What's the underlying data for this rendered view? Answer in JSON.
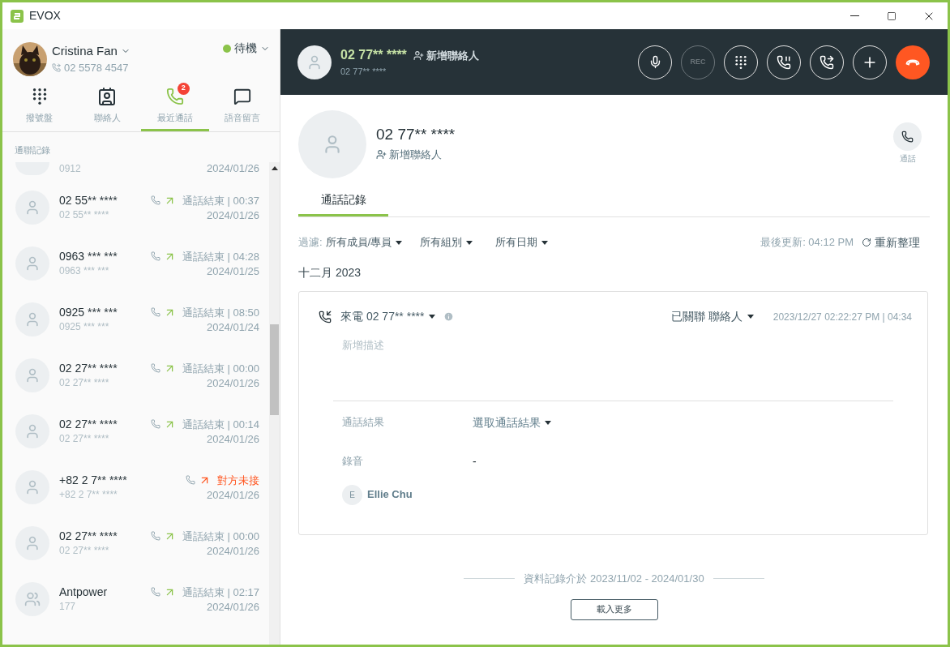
{
  "window": {
    "title": "EVOX"
  },
  "user": {
    "name": "Cristina Fan",
    "phone": "02 5578 4547",
    "status": {
      "label": "待機",
      "color": "#8bc34a"
    }
  },
  "nav_tabs": [
    {
      "kind": "dialpad",
      "label": "撥號盤",
      "selected": false
    },
    {
      "kind": "contacts",
      "label": "聯絡人",
      "selected": false
    },
    {
      "kind": "recent",
      "label": "最近通話",
      "selected": true,
      "badge": "2"
    },
    {
      "kind": "voicemail",
      "label": "語音留言",
      "selected": false
    }
  ],
  "section_label": "通聯記錄",
  "partial_row": {
    "sub": "0912",
    "date": "2024/01/26"
  },
  "calls": [
    {
      "kind": "person",
      "number": "02 55** ****",
      "sub": "02 55** ****",
      "status": "通話結束 | 00:37",
      "date": "2024/01/26",
      "missed": false
    },
    {
      "kind": "person",
      "number": "0963 *** ***",
      "sub": "0963 *** ***",
      "status": "通話結束 | 04:28",
      "date": "2024/01/25",
      "missed": false
    },
    {
      "kind": "person",
      "number": "0925 *** ***",
      "sub": "0925 *** ***",
      "status": "通話結束 | 08:50",
      "date": "2024/01/24",
      "missed": false
    },
    {
      "kind": "person",
      "number": "02 27** ****",
      "sub": "02 27** ****",
      "status": "通話結束 | 00:00",
      "date": "2024/01/26",
      "missed": false
    },
    {
      "kind": "person",
      "number": "02 27** ****",
      "sub": "02 27** ****",
      "status": "通話結束 | 00:14",
      "date": "2024/01/26",
      "missed": false
    },
    {
      "kind": "person",
      "number": "+82 2 7** ****",
      "sub": "+82 2 7** ****",
      "status": "對方未接",
      "date": "2024/01/26",
      "missed": true
    },
    {
      "kind": "person",
      "number": "02 27** ****",
      "sub": "02 27** ****",
      "status": "通話結束 | 00:00",
      "date": "2024/01/26",
      "missed": false
    },
    {
      "kind": "group",
      "number": "Antpower",
      "sub": "177",
      "status": "通話結束 | 02:17",
      "date": "2024/01/26",
      "missed": false
    }
  ],
  "active_call": {
    "number": "02 77** ****",
    "add_contact": "新增聯絡人",
    "sub": "02 77** ****",
    "controls": [
      {
        "kind": "mute",
        "disabled": false
      },
      {
        "kind": "record",
        "label": "REC",
        "disabled": true
      },
      {
        "kind": "dialpad",
        "disabled": false
      },
      {
        "kind": "hold",
        "disabled": false
      },
      {
        "kind": "transfer",
        "disabled": false
      },
      {
        "kind": "add",
        "disabled": false
      },
      {
        "kind": "hangup",
        "disabled": false
      }
    ]
  },
  "contact": {
    "number": "02 77** ****",
    "add_contact": "新增聯絡人",
    "call_label": "通話"
  },
  "tabs": [
    {
      "label": "通話記錄",
      "selected": true
    }
  ],
  "filter": {
    "label": "過濾:",
    "dropdowns": [
      "所有成員/專員",
      "所有組別",
      "所有日期"
    ],
    "last_updated": "最後更新: 04:12 PM",
    "refresh": "重新整理"
  },
  "month": "十二月 2023",
  "record": {
    "title": "來電 02 77** ****",
    "link": "已關聯 聯絡人",
    "time": "2023/12/27 02:22:27 PM | 04:34",
    "description_placeholder": "新增描述",
    "fields": [
      {
        "kind": "dropdown",
        "label": "通話結果",
        "value": "選取通話結果"
      },
      {
        "kind": "text",
        "label": "錄音",
        "value": "-"
      }
    ],
    "agent": {
      "initial": "E",
      "name": "Ellie Chu"
    }
  },
  "range_note": "資料記錄介於 2023/11/02 - 2024/01/30",
  "load_more": "載入更多"
}
